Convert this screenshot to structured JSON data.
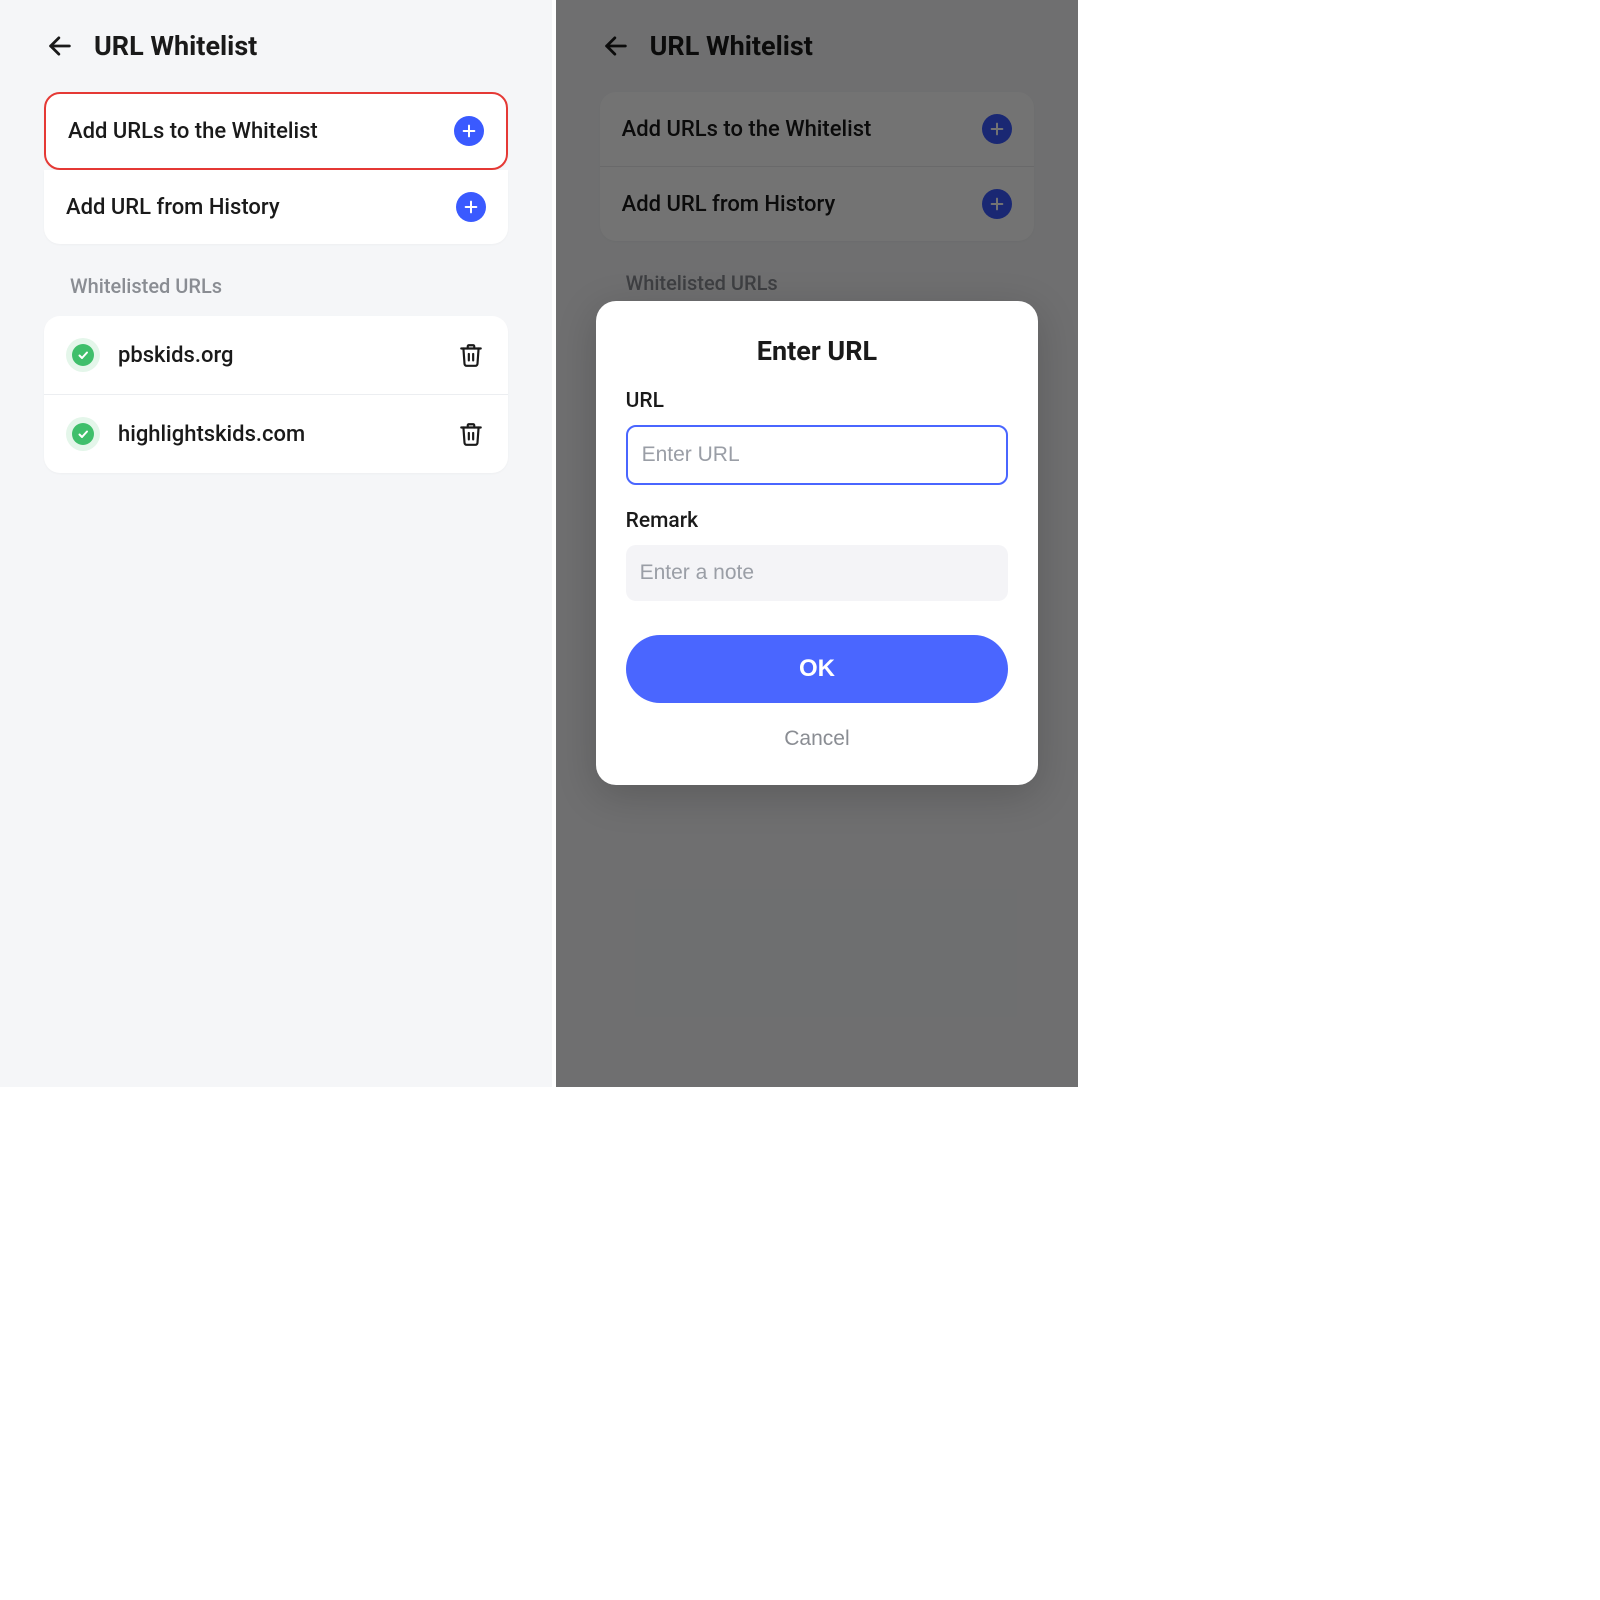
{
  "header": {
    "title": "URL Whitelist"
  },
  "actions": {
    "add_urls_label": "Add URLs to the Whitelist",
    "add_history_label": "Add URL from History"
  },
  "section_title": "Whitelisted URLs",
  "whitelist": [
    {
      "url": "pbskids.org"
    },
    {
      "url": "highlightskids.com"
    }
  ],
  "modal": {
    "title": "Enter URL",
    "url_label": "URL",
    "url_placeholder": "Enter URL",
    "remark_label": "Remark",
    "remark_placeholder": "Enter a note",
    "ok_label": "OK",
    "cancel_label": "Cancel"
  }
}
